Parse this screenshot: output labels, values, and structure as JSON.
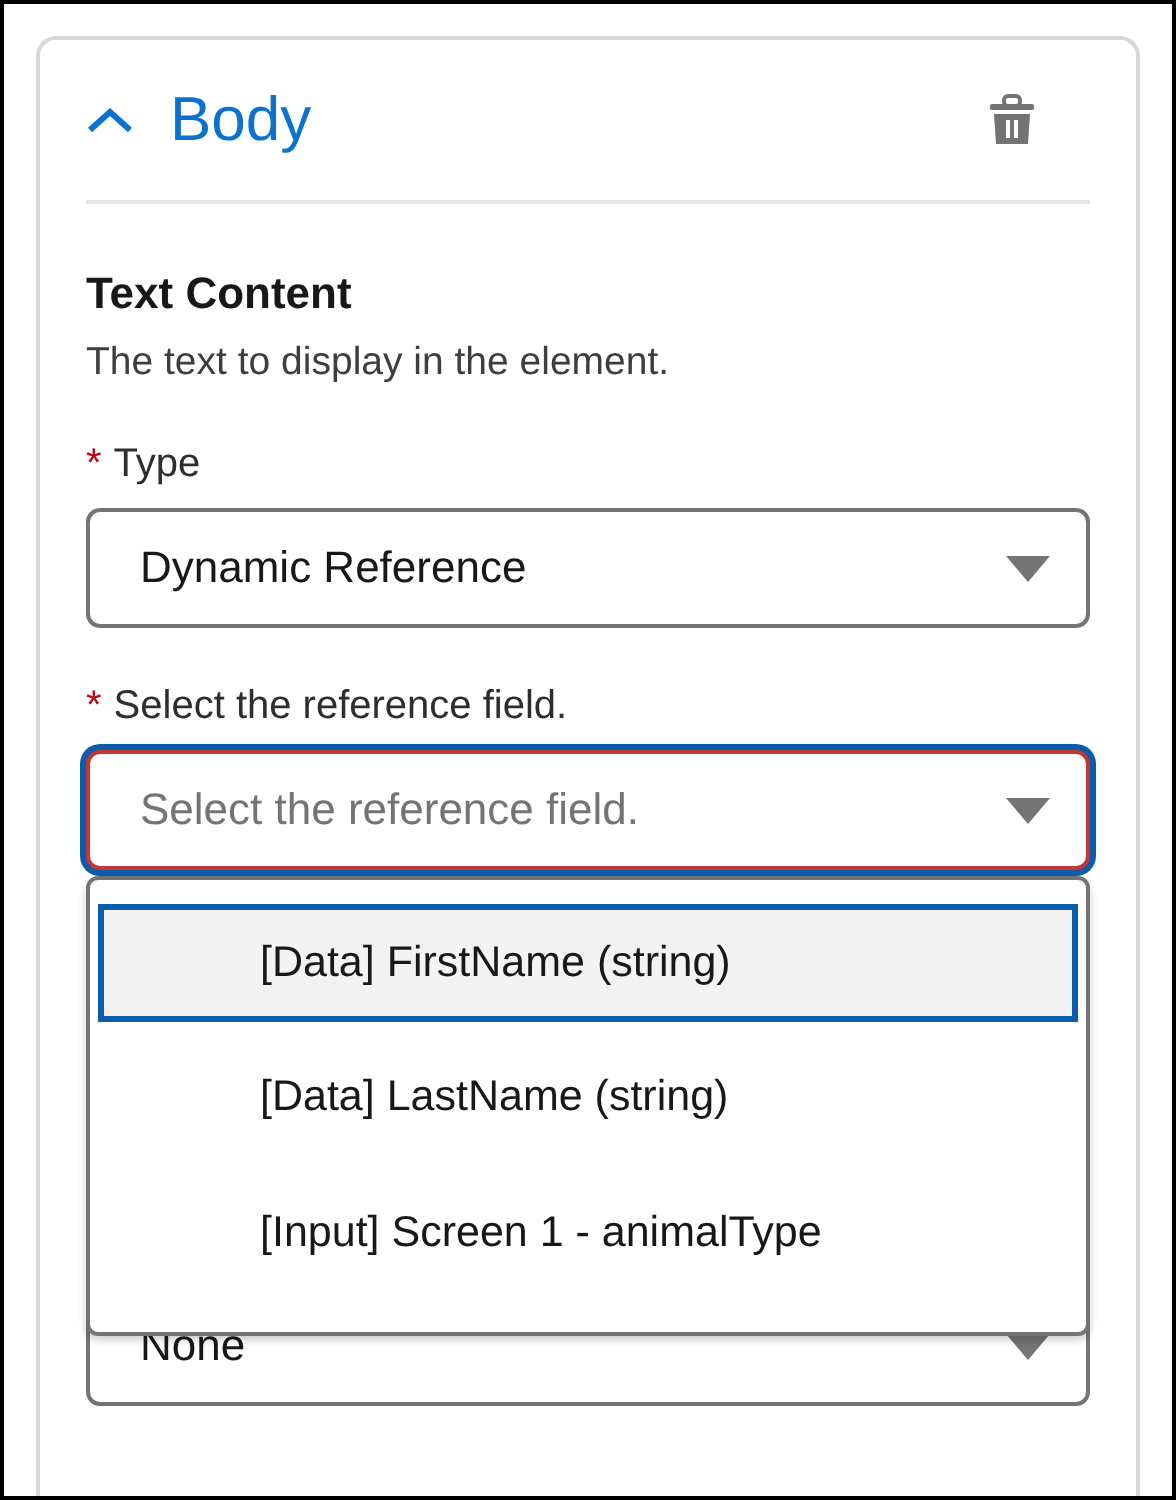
{
  "section": {
    "title": "Body",
    "expanded": true
  },
  "group": {
    "title": "Text Content",
    "description": "The text to display in the element."
  },
  "type_field": {
    "label": "Type",
    "required_mark": "*",
    "value": "Dynamic Reference"
  },
  "reference_field": {
    "label": "Select the reference field.",
    "required_mark": "*",
    "placeholder": "Select the reference field.",
    "focused": true,
    "error": true
  },
  "dropdown_options": [
    {
      "label": "[Data] FirstName (string)",
      "selected": true
    },
    {
      "label": "[Data] LastName (string)",
      "selected": false
    },
    {
      "label": "[Input] Screen 1 - animalType",
      "selected": false
    }
  ],
  "hidden_select": {
    "value": "None"
  }
}
